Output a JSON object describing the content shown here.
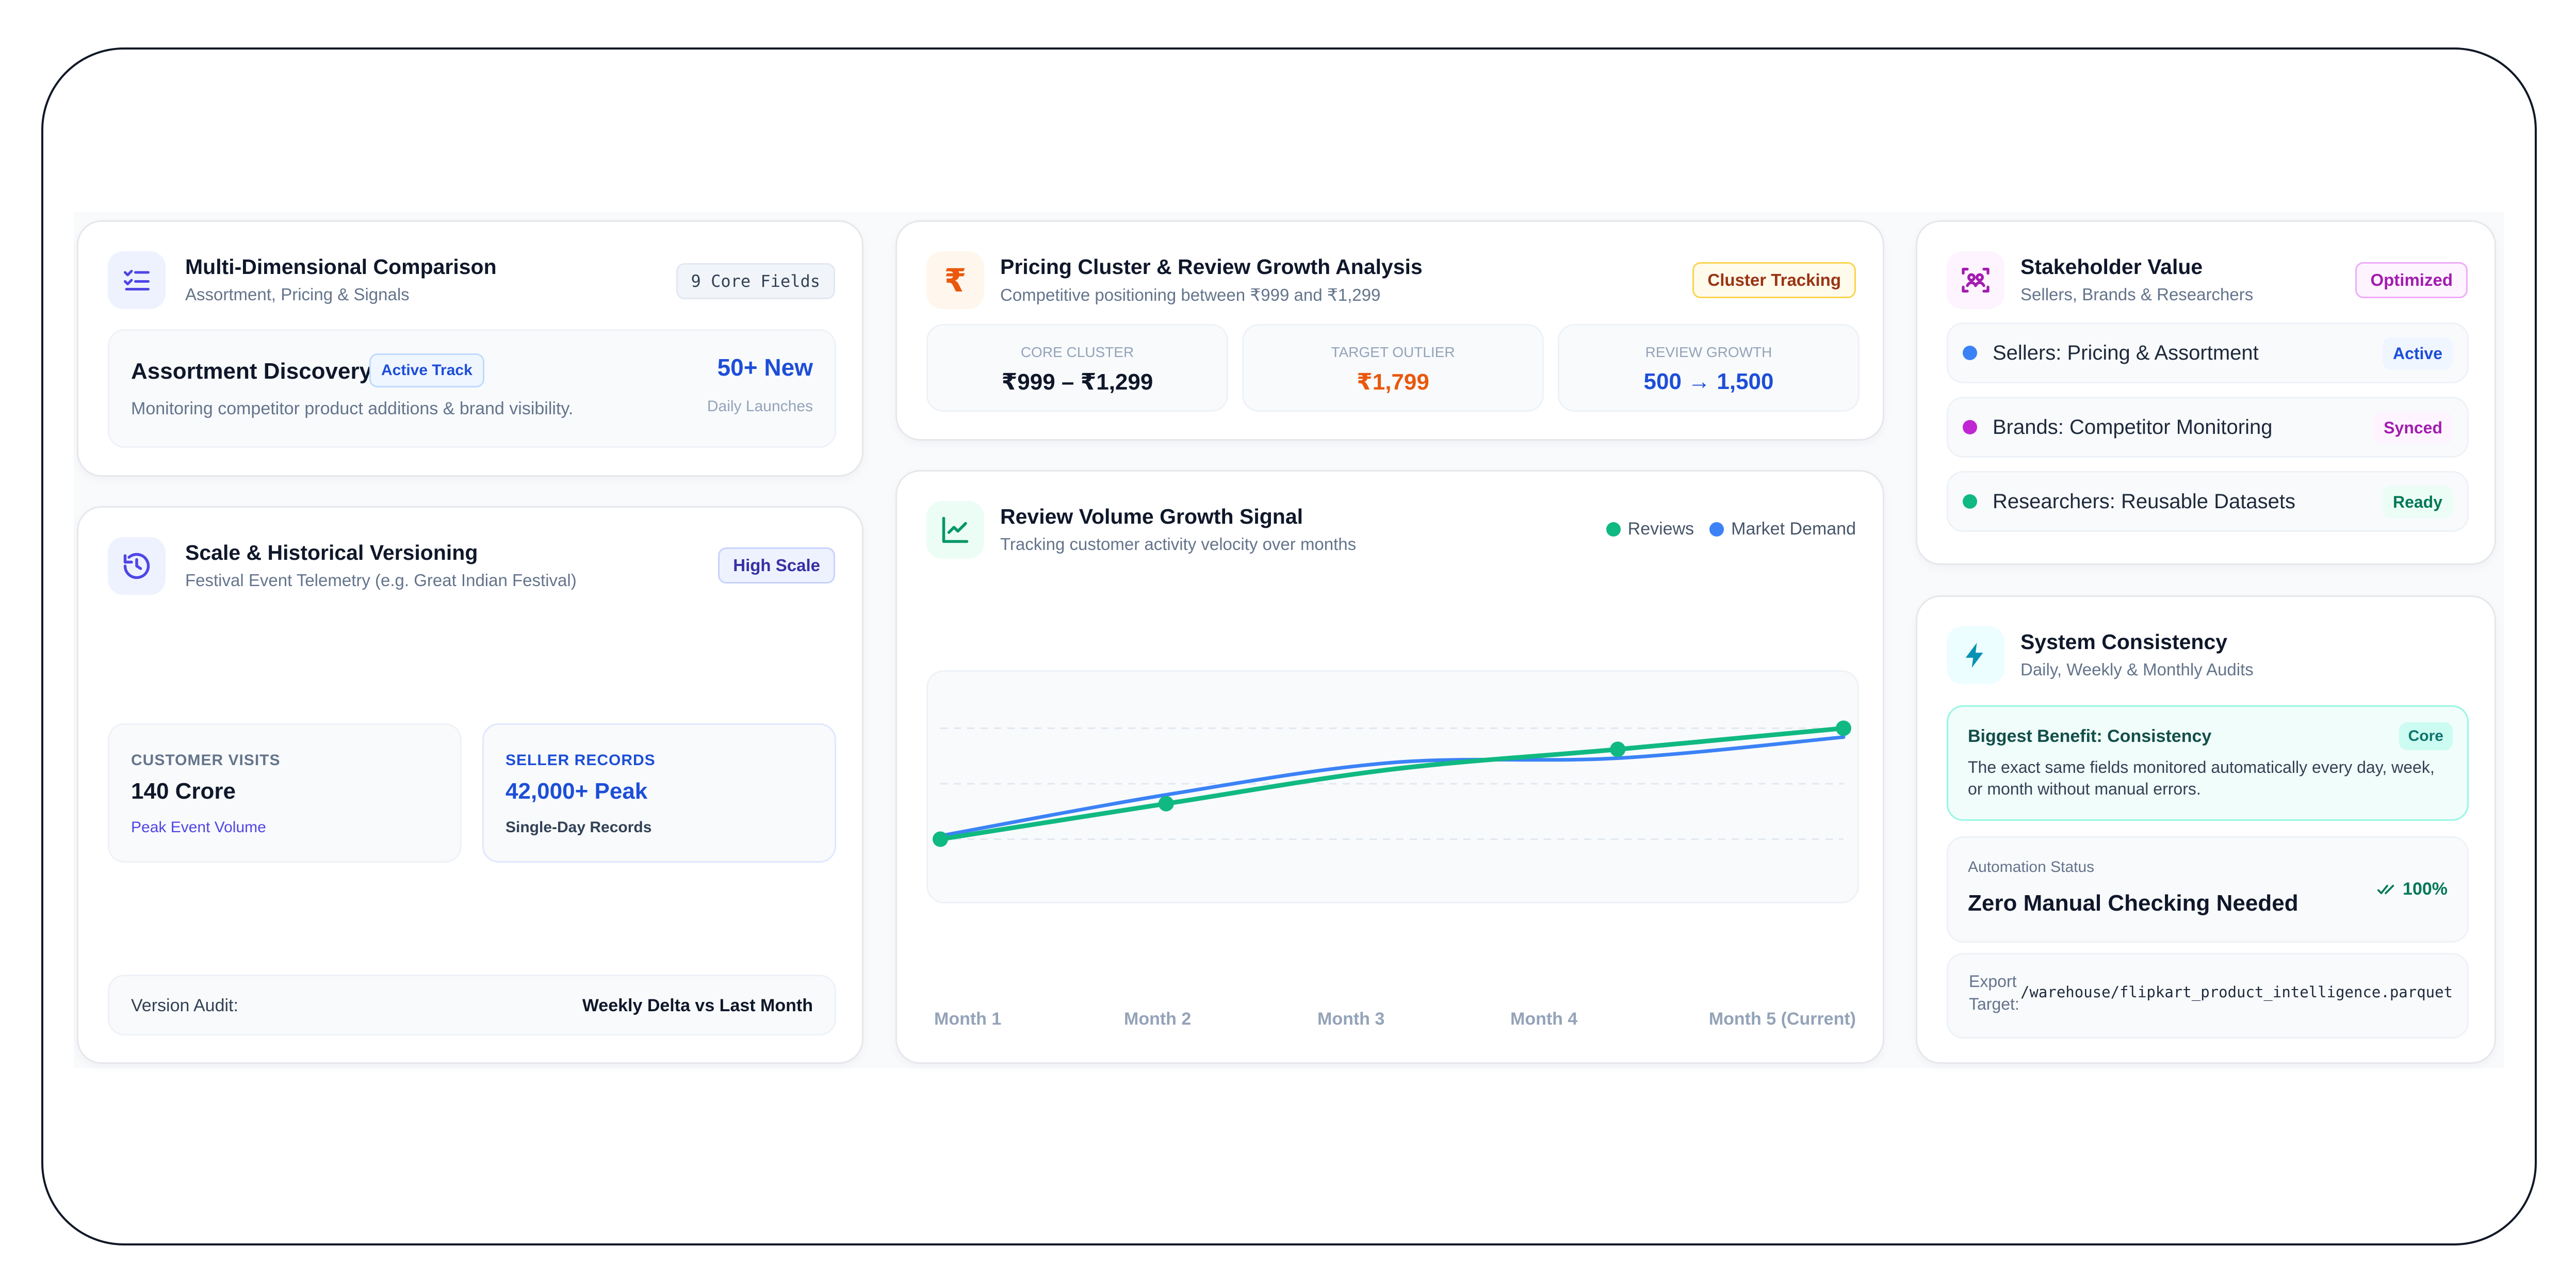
{
  "comparison": {
    "title": "Multi-Dimensional Comparison",
    "subtitle": "Assortment, Pricing & Signals",
    "badge": "9 Core Fields",
    "icon": "checklist-icon",
    "discovery": {
      "title": "Assortment Discovery",
      "tag": "Active Track",
      "desc": "Monitoring competitor product additions & brand visibility.",
      "value": "50+ New",
      "value_label": "Daily Launches"
    }
  },
  "scale": {
    "title": "Scale & Historical Versioning",
    "subtitle": "Festival Event Telemetry (e.g. Great Indian Festival)",
    "badge": "High Scale",
    "icon": "history-icon",
    "visits": {
      "label": "CUSTOMER VISITS",
      "value": "140 Crore",
      "note": "Peak Event Volume"
    },
    "records": {
      "label": "SELLER RECORDS",
      "value": "42,000+ Peak",
      "note": "Single-Day Records"
    },
    "audit": {
      "label": "Version Audit:",
      "value": "Weekly Delta vs Last Month"
    }
  },
  "pricing": {
    "title": "Pricing Cluster & Review Growth Analysis",
    "subtitle": "Competitive positioning between ₹999 and ₹1,299",
    "badge": "Cluster Tracking",
    "icon": "rupee-icon",
    "stats": [
      {
        "label": "CORE CLUSTER",
        "value": "₹999 – ₹1,299"
      },
      {
        "label": "TARGET OUTLIER",
        "value": "₹1,799"
      },
      {
        "label": "REVIEW GROWTH",
        "value": "500 → 1,500"
      }
    ]
  },
  "growth": {
    "title": "Review Volume Growth Signal",
    "subtitle": "Tracking customer activity velocity over months",
    "icon": "trend-chart-icon",
    "legend": [
      "Reviews",
      "Market Demand"
    ],
    "months": [
      "Month 1",
      "Month 2",
      "Month 3",
      "Month 4",
      "Month 5 (Current)"
    ]
  },
  "stakeholder": {
    "title": "Stakeholder Value",
    "subtitle": "Sellers, Brands & Researchers",
    "badge": "Optimized",
    "icon": "users-scan-icon",
    "items": [
      {
        "label": "Sellers: Pricing & Assortment",
        "status": "Active"
      },
      {
        "label": "Brands: Competitor Monitoring",
        "status": "Synced"
      },
      {
        "label": "Researchers: Reusable Datasets",
        "status": "Ready"
      }
    ]
  },
  "consistency": {
    "title": "System Consistency",
    "subtitle": "Daily, Weekly & Monthly Audits",
    "icon": "lightning-icon",
    "benefit": {
      "title": "Biggest Benefit: Consistency",
      "tag": "Core",
      "text": "The exact same fields monitored automatically every day, week, or month without manual errors."
    },
    "automation": {
      "label": "Automation Status",
      "value": "Zero Manual Checking Needed",
      "pct": "100%"
    },
    "export": {
      "label_line1": "Export",
      "label_line2": "Target:",
      "path": "/warehouse/flipkart_product_intelligence.parquet"
    }
  },
  "colors": {
    "reviews": "#10b981",
    "demand": "#3b82f6",
    "accent_blue": "#1d4ed8",
    "accent_orange": "#ea580c",
    "accent_purple": "#a21caf"
  },
  "chart_data": {
    "type": "line",
    "categories": [
      "Month 1",
      "Month 2",
      "Month 3",
      "Month 4",
      "Month 5 (Current)"
    ],
    "series": [
      {
        "name": "Reviews",
        "values": [
          500,
          820,
          1130,
          1310,
          1500
        ]
      },
      {
        "name": "Market Demand",
        "values": [
          530,
          900,
          1190,
          1230,
          1420
        ]
      }
    ],
    "ylim": [
      0,
      2000
    ],
    "grid": true,
    "legend": "top-right"
  }
}
